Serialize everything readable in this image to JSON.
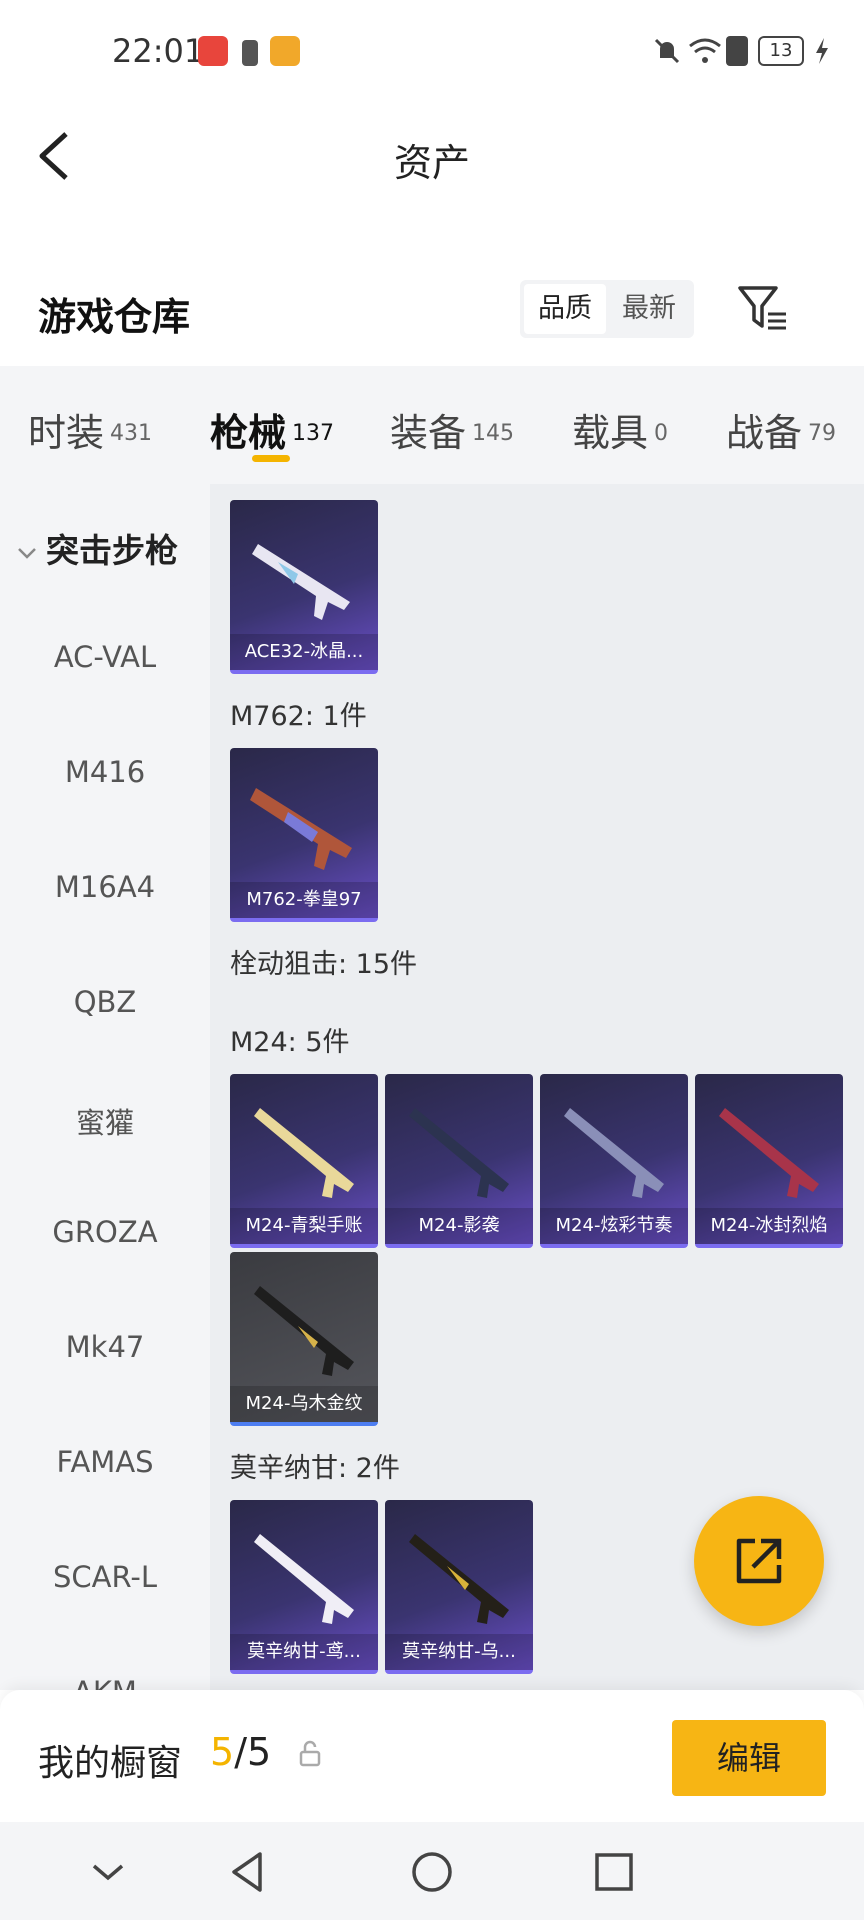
{
  "status_bar": {
    "time": "22:01",
    "battery": "13"
  },
  "app_bar": {
    "title": "资产"
  },
  "warehouse": {
    "title": "游戏仓库",
    "sort_options": [
      "品质",
      "最新"
    ],
    "active_sort": "品质"
  },
  "tabs": [
    {
      "label": "时装",
      "count": "431"
    },
    {
      "label": "枪械",
      "count": "137"
    },
    {
      "label": "装备",
      "count": "145"
    },
    {
      "label": "载具",
      "count": "0"
    },
    {
      "label": "战备",
      "count": "79"
    }
  ],
  "active_tab": "枪械",
  "sidebar": {
    "category": "突击步枪",
    "items": [
      "AC-VAL",
      "M416",
      "M16A4",
      "QBZ",
      "蜜獾",
      "GROZA",
      "Mk47",
      "FAMAS",
      "SCAR-L",
      "AKM"
    ]
  },
  "content": {
    "cards_top": [
      {
        "name": "ACE32-冰晶..."
      }
    ],
    "group_m762": "M762: 1件",
    "cards_m762": [
      {
        "name": "M762-拳皇97"
      }
    ],
    "group_sniper": "栓动狙击: 15件",
    "group_m24": "M24: 5件",
    "cards_m24": [
      {
        "name": "M24-青梨手账"
      },
      {
        "name": "M24-影袭"
      },
      {
        "name": "M24-炫彩节奏"
      },
      {
        "name": "M24-冰封烈焰"
      },
      {
        "name": "M24-乌木金纹"
      }
    ],
    "group_mosin": "莫辛纳甘: 2件",
    "cards_mosin": [
      {
        "name": "莫辛纳甘-鸢..."
      },
      {
        "name": "莫辛纳甘-乌..."
      }
    ]
  },
  "showcase": {
    "title": "我的橱窗",
    "current": "5",
    "separator": "/",
    "total": "5",
    "edit_label": "编辑"
  },
  "colors": {
    "accent": "#f7b514",
    "card_purple": "#3a3470",
    "sidebar_bg": "#f4f5f7"
  }
}
